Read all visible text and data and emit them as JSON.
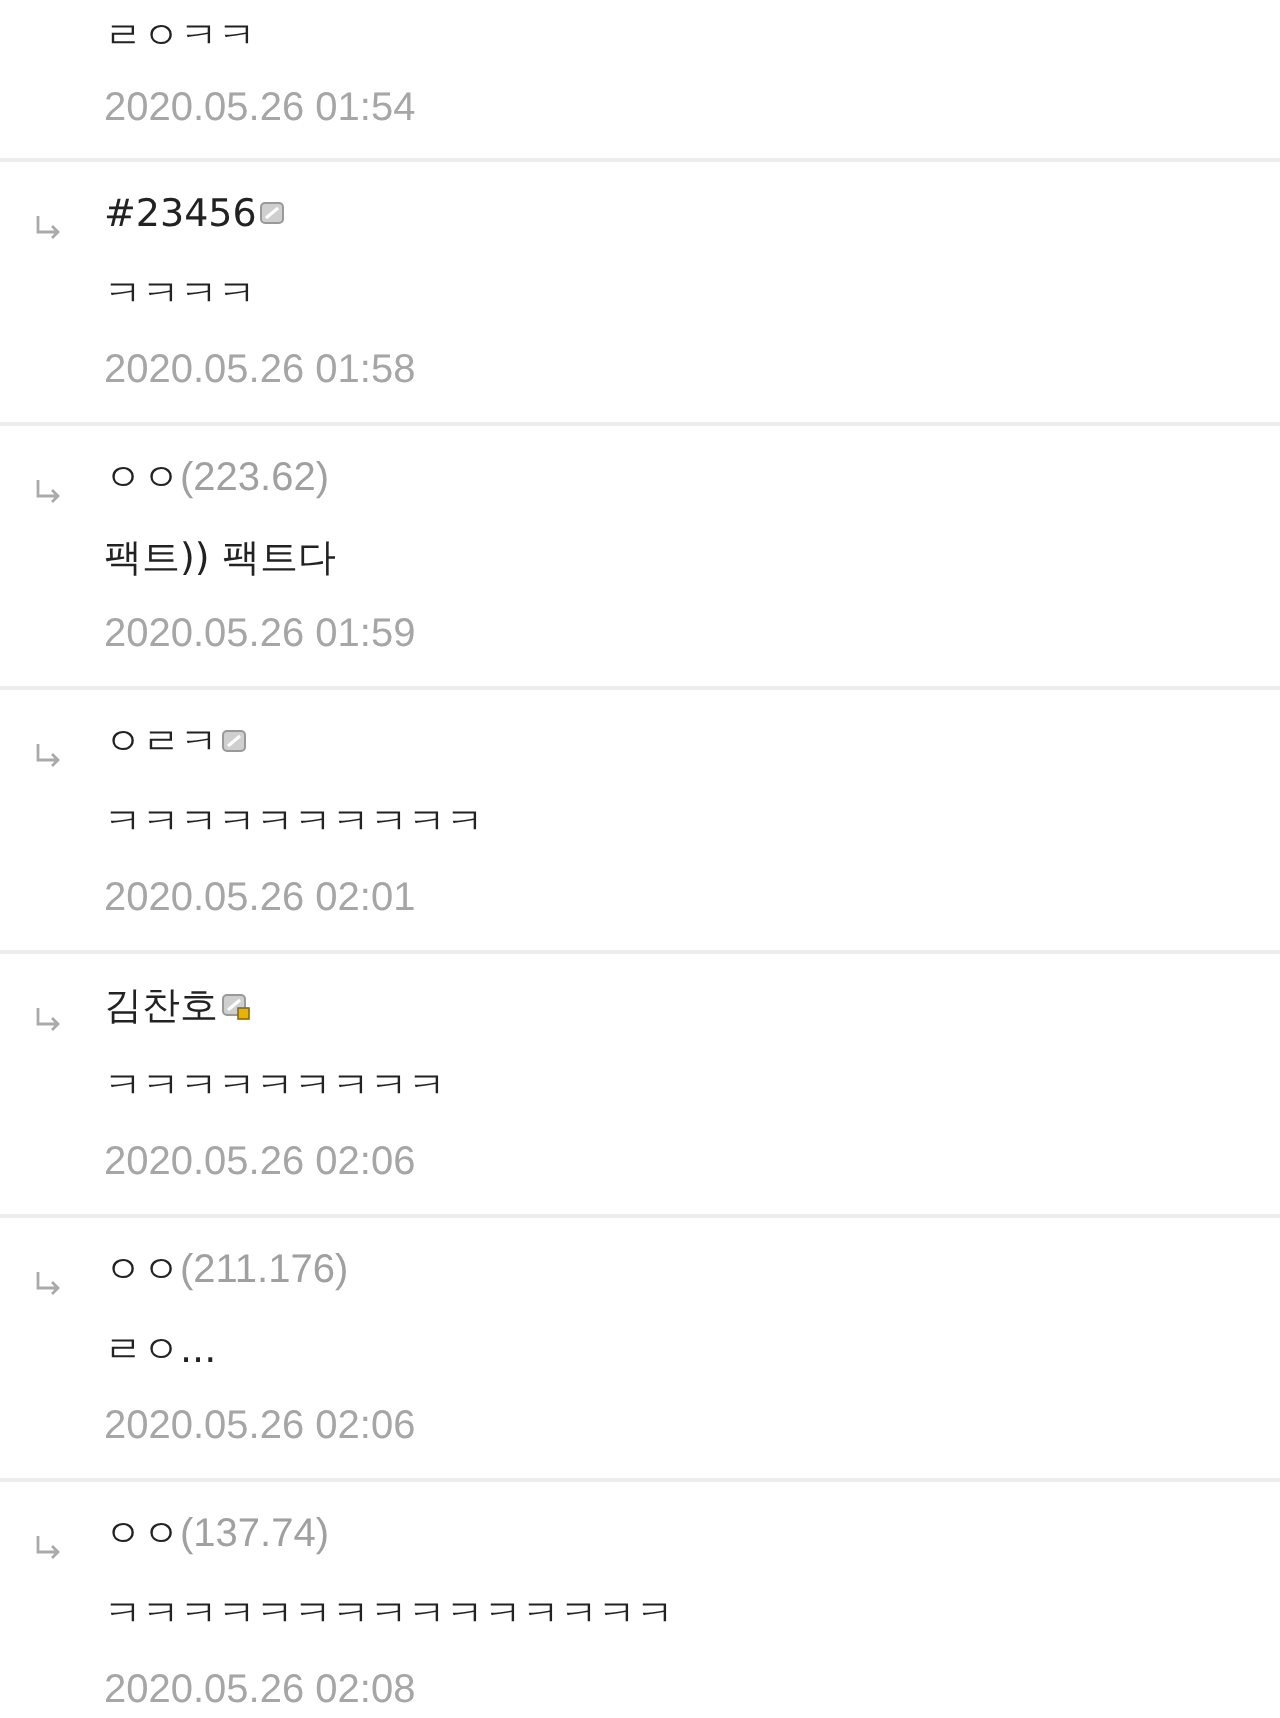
{
  "comments": [
    {
      "body": "ㄹㅇㅋㅋ",
      "date": "2020.05.26 01:54"
    },
    {
      "author": {
        "name": "#23456",
        "badge": true,
        "locked": false
      },
      "body": "ㅋㅋㅋㅋ",
      "date": "2020.05.26 01:58"
    },
    {
      "author": {
        "name": "ㅇㅇ",
        "ip": "(223.62)"
      },
      "body": "팩트)) 팩트다",
      "date": "2020.05.26 01:59"
    },
    {
      "author": {
        "name": "ㅇㄹㅋ",
        "badge": true,
        "locked": false
      },
      "body": "ㅋㅋㅋㅋㅋㅋㅋㅋㅋㅋ",
      "date": "2020.05.26 02:01"
    },
    {
      "author": {
        "name": "김찬호",
        "badge": true,
        "locked": true
      },
      "body": "ㅋㅋㅋㅋㅋㅋㅋㅋㅋ",
      "date": "2020.05.26 02:06"
    },
    {
      "author": {
        "name": "ㅇㅇ",
        "ip": "(211.176)"
      },
      "body": "ㄹㅇ...",
      "date": "2020.05.26 02:06"
    },
    {
      "author": {
        "name": "ㅇㅇ",
        "ip": "(137.74)"
      },
      "body": "ㅋㅋㅋㅋㅋㅋㅋㅋㅋㅋㅋㅋㅋㅋㅋ",
      "date": "2020.05.26 02:08"
    }
  ]
}
